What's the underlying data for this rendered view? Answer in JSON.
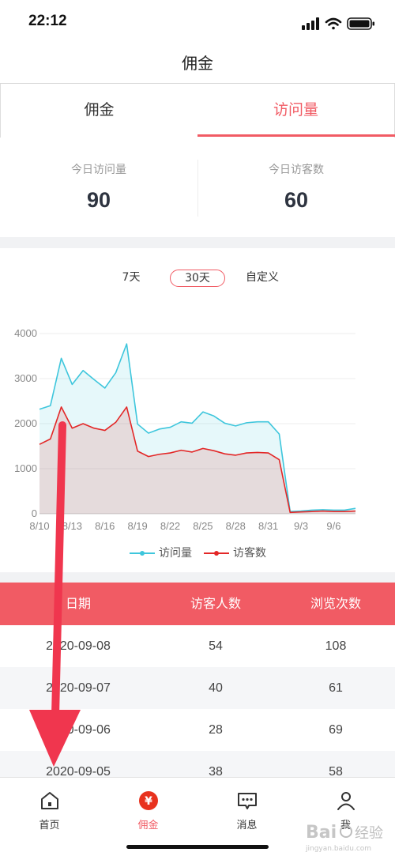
{
  "status": {
    "time": "22:12"
  },
  "nav": {
    "title": "佣金"
  },
  "tabs": [
    {
      "label": "佣金",
      "active": false
    },
    {
      "label": "访问量",
      "active": true
    }
  ],
  "stats": {
    "today_visits_label": "今日访问量",
    "today_visits_value": "90",
    "today_visitors_label": "今日访客数",
    "today_visitors_value": "60"
  },
  "range": {
    "options": [
      "7天",
      "30天",
      "自定义"
    ],
    "selected": "30天"
  },
  "colors": {
    "accent": "#f15b64",
    "visits": "#3ec6dc",
    "visitors": "#e32727"
  },
  "chart_data": {
    "type": "area",
    "x_ticks": [
      "8/10",
      "8/13",
      "8/16",
      "8/19",
      "8/22",
      "8/25",
      "8/28",
      "8/31",
      "9/3",
      "9/6"
    ],
    "y_ticks": [
      0,
      1000,
      2000,
      3000,
      4000
    ],
    "ylim": [
      0,
      4000
    ],
    "grid": true,
    "legend_position": "bottom",
    "x": [
      "8/10",
      "8/11",
      "8/12",
      "8/13",
      "8/14",
      "8/15",
      "8/16",
      "8/17",
      "8/18",
      "8/19",
      "8/20",
      "8/21",
      "8/22",
      "8/23",
      "8/24",
      "8/25",
      "8/26",
      "8/27",
      "8/28",
      "8/29",
      "8/30",
      "8/31",
      "9/1",
      "9/2",
      "9/3",
      "9/4",
      "9/5",
      "9/6",
      "9/7",
      "9/8"
    ],
    "series": [
      {
        "name": "访问量",
        "values": [
          2320,
          2400,
          3450,
          2870,
          3180,
          2980,
          2790,
          3130,
          3770,
          1990,
          1790,
          1880,
          1920,
          2040,
          2010,
          2260,
          2170,
          2010,
          1950,
          2020,
          2040,
          2040,
          1770,
          50,
          60,
          80,
          90,
          80,
          80,
          120
        ]
      },
      {
        "name": "访客数",
        "values": [
          1540,
          1660,
          2370,
          1900,
          2000,
          1900,
          1850,
          2030,
          2370,
          1390,
          1270,
          1320,
          1350,
          1410,
          1370,
          1450,
          1400,
          1330,
          1300,
          1350,
          1360,
          1350,
          1200,
          30,
          40,
          50,
          60,
          50,
          50,
          60
        ]
      }
    ]
  },
  "table": {
    "headers": [
      "日期",
      "访客人数",
      "浏览次数"
    ],
    "rows": [
      [
        "2020-09-08",
        "54",
        "108"
      ],
      [
        "2020-09-07",
        "40",
        "61"
      ],
      [
        "2020-09-06",
        "28",
        "69"
      ],
      [
        "2020-09-05",
        "38",
        "58"
      ]
    ]
  },
  "tabbar": [
    {
      "label": "首页",
      "icon": "home-icon",
      "active": false
    },
    {
      "label": "佣金",
      "icon": "yen-coin-icon",
      "active": true
    },
    {
      "label": "消息",
      "icon": "message-icon",
      "active": false
    },
    {
      "label": "我",
      "icon": "person-icon",
      "active": false
    }
  ],
  "tabbar_icon_glyph": "¥",
  "watermark": {
    "text": "Bai 经验",
    "subtext": "jingyan.baidu.com"
  }
}
